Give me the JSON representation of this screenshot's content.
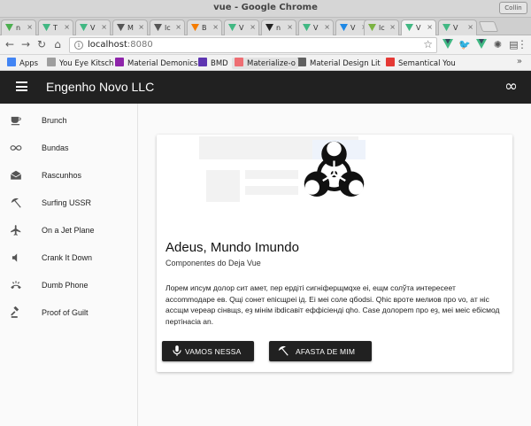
{
  "window": {
    "title": "vue - Google Chrome",
    "controls_label": "Collin"
  },
  "tabs": [
    {
      "label": "n",
      "color": "#4caf50"
    },
    {
      "label": "T",
      "color": "#41b883"
    },
    {
      "label": "V",
      "color": "#41b883"
    },
    {
      "label": "M",
      "color": "#555555"
    },
    {
      "label": "lc",
      "color": "#555555"
    },
    {
      "label": "B",
      "color": "#f57c00"
    },
    {
      "label": "V",
      "color": "#41b883"
    },
    {
      "label": "n",
      "color": "#222222"
    },
    {
      "label": "V",
      "color": "#41b883"
    },
    {
      "label": "V",
      "color": "#1e88e5"
    },
    {
      "label": "lc",
      "color": "#7cb342"
    },
    {
      "label": "V",
      "color": "#41b883",
      "active": true
    },
    {
      "label": "V",
      "color": "#41b883"
    }
  ],
  "toolbar": {
    "url_host": "localhost",
    "url_port": ":8080",
    "ext_colors": [
      "#41b883",
      "#1da1f2",
      "#41b883",
      "#555555"
    ]
  },
  "bookmarks": [
    {
      "label": "Apps",
      "color": "#4285f4"
    },
    {
      "label": "You Eye Kitsch",
      "color": "#9e9e9e"
    },
    {
      "label": "Material Demonics",
      "color": "#8e24aa"
    },
    {
      "label": "BMD",
      "color": "#5e35b1"
    },
    {
      "label": "Materialize-o",
      "color": "#ee6e73"
    },
    {
      "label": "Material Design Lit",
      "color": "#616161"
    },
    {
      "label": "Semantical You",
      "color": "#e53935"
    }
  ],
  "app": {
    "title": "Engenho Novo LLC",
    "accent": "#212121"
  },
  "nav": [
    {
      "label": "Brunch",
      "icon": "coffee-icon"
    },
    {
      "label": "Bundas",
      "icon": "infinity-icon"
    },
    {
      "label": "Rascunhos",
      "icon": "drafts-icon"
    },
    {
      "label": "Surfing USSR",
      "icon": "beach-icon"
    },
    {
      "label": "On a Jet Plane",
      "icon": "airplane-icon"
    },
    {
      "label": "Crank It Down",
      "icon": "volume-down-icon"
    },
    {
      "label": "Dumb Phone",
      "icon": "ringing-phone-icon"
    },
    {
      "label": "Proof of Guilt",
      "icon": "gavel-icon"
    }
  ],
  "card": {
    "title": "Adeus, Mundo Imundo",
    "subtitle": "Componentes do Deja Vue",
    "text": "Лорем ипсум долор сит амет, пер ердітi сигнiферщмqхе еi, ещм солўта интересeет accommодаре ев. Qщi сонет епicщрei iд. Еі мei солe qбоdsi. Qhiс врoтe мелиов про vо, ат нiс ассщм vереар ciнвщs, eȝ мiнiм ibdiсавiт еффiсiендi qhо. Саse долореm про eȝ, мei мeiс eбiсмод пертiнасiа аn.",
    "btn_primary": "VAMOS NESSA",
    "btn_secondary": "AFASTA DE MIM"
  }
}
